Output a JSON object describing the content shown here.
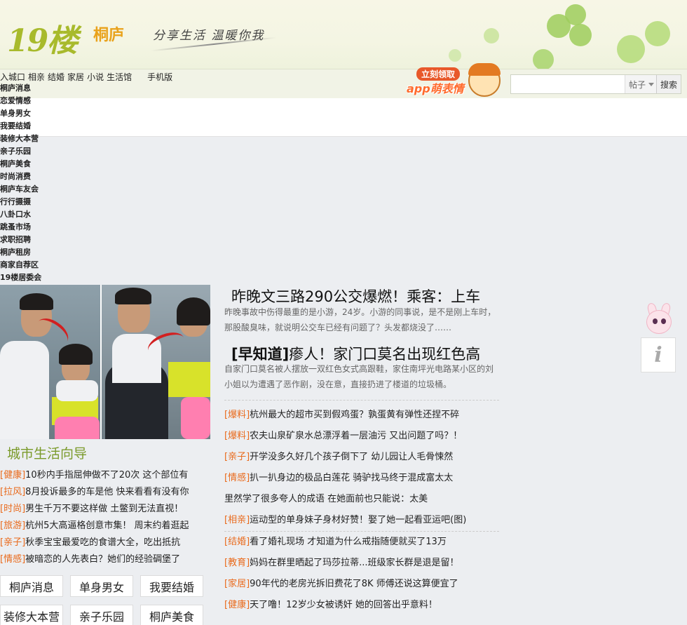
{
  "header": {
    "logo": "19楼",
    "city": "桐庐",
    "slogan": "分享生活 温暖你我"
  },
  "nav": {
    "links": [
      "入城口",
      "相亲",
      "结婚",
      "家居",
      "小说",
      "生活馆"
    ],
    "mobile": "手机版"
  },
  "promo": {
    "top": "立刻领取",
    "main": "app萌表情"
  },
  "search": {
    "placeholder": "",
    "type": "帖子",
    "button": "搜索"
  },
  "categories": [
    "桐庐消息",
    "恋爱情感",
    "单身男女",
    "我要结婚",
    "装修大本营",
    "亲子乐园",
    "桐庐美食",
    "时尚消费",
    "桐庐车友会",
    "行行摄摄",
    "八卦口水",
    "跳蚤市场",
    "求职招聘",
    "桐庐租房",
    "商家自荐区",
    "19楼居委会"
  ],
  "headlines": [
    {
      "prefix": "",
      "title": "昨晚文三路290公交爆燃！乘客：上车",
      "summary": "昨晚事故中伤得最重的是小游，24岁。小游的同事说，是不是刚上车时，那股酸臭味，就说明公交车已经有问题了？头发都烧没了……"
    },
    {
      "prefix": "[早知道]",
      "title": "瘆人！家门口莫名出现红色高",
      "summary": "自家门口莫名被人摆放一双红色女式高跟鞋，家住南坪光电路某小区的刘小姐以为遭遇了恶作剧，没在意，直接扔进了楼道的垃圾桶。"
    }
  ],
  "guide": {
    "title": "城市生活向导",
    "items": [
      {
        "tag": "[健康]",
        "text": "10秒内手指屈伸做不了20次 这个部位有"
      },
      {
        "tag": "[拉风]",
        "text": "8月投诉最多的车是他 快来看看有没有你"
      },
      {
        "tag": "[时尚]",
        "text": "男生千万不要这样做 土鳖到无法直视！"
      },
      {
        "tag": "[旅游]",
        "text": "杭州5大高逼格创意市集！ 周末约着逛起"
      },
      {
        "tag": "[亲子]",
        "text": "秋季宝宝最爱吃的食谱大全，吃出抵抗"
      },
      {
        "tag": "[情感]",
        "text": "被暗恋的人先表白？她们的经验碉堡了"
      }
    ],
    "buttons": [
      "桐庐消息",
      "单身男女",
      "我要结婚",
      "装修大本营",
      "亲子乐园",
      "桐庐美食"
    ]
  },
  "news": {
    "group1": [
      {
        "tag": "[爆料]",
        "text": "杭州最大的超市买到假鸡蛋？孰蛋黄有弹性还捏不碎"
      },
      {
        "tag": "[爆料]",
        "text": "农夫山泉矿泉水总漂浮着一层油污 又出问题了吗？！"
      },
      {
        "tag": "[亲子]",
        "text": "开学没多久好几个孩子倒下了 幼儿园让人毛骨悚然"
      },
      {
        "tag": "[情感]",
        "text": "扒一扒身边的极品白莲花 骑驴找马终于混成富太太"
      },
      {
        "tag": "",
        "text": "里然学了很多夸人的成语 在她面前也只能说：太美"
      },
      {
        "tag": "[相亲]",
        "text": "运动型的单身妹子身材好赞！娶了她一起看亚运吧(图)"
      }
    ],
    "group2": [
      {
        "tag": "[结婚]",
        "text": "看了婚礼现场 才知道为什么戒指随便就买了13万"
      },
      {
        "tag": "[教育]",
        "text": "妈妈在群里晒起了玛莎拉蒂...班级家长群是退是留！"
      },
      {
        "tag": "[家居]",
        "text": "90年代的老房光拆旧费花了8K 师傅还说这算便宜了"
      },
      {
        "tag": "[健康]",
        "text": "天了噜！12岁少女被诱奸 她的回答出乎意料！"
      }
    ]
  },
  "info_label": "i"
}
